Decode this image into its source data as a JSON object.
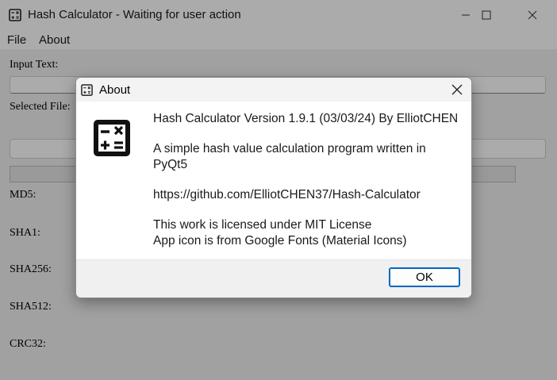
{
  "window": {
    "title": "Hash Calculator - Waiting for user action",
    "icon": "calculator-icon",
    "controls": [
      "minimize-icon",
      "maximize-icon",
      "close-icon"
    ]
  },
  "menubar": {
    "file": "File",
    "about": "About"
  },
  "main": {
    "input_text_label": "Input Text:",
    "input_text_value": "",
    "selected_file_label": "Selected File:",
    "selected_file_value": "",
    "progress": 0,
    "hash_labels": {
      "md5": "MD5:",
      "sha1": "SHA1:",
      "sha256": "SHA256:",
      "sha512": "SHA512:",
      "crc32": "CRC32:"
    }
  },
  "about_dialog": {
    "title": "About",
    "icon": "calculator-icon",
    "version_line": "Hash Calculator Version 1.9.1 (03/03/24) By ElliotCHEN",
    "description_line1": "A simple hash value calculation program written in",
    "description_line2": "PyQt5",
    "url": "https://github.com/ElliotCHEN37/Hash-Calculator",
    "license_line": "This work is licensed under MIT License",
    "icon_credit_line": "App icon is from Google Fonts (Material Icons)",
    "ok_label": "OK"
  },
  "colors": {
    "accent": "#0067c0",
    "overlay": "rgba(0,0,0,0.33)"
  }
}
